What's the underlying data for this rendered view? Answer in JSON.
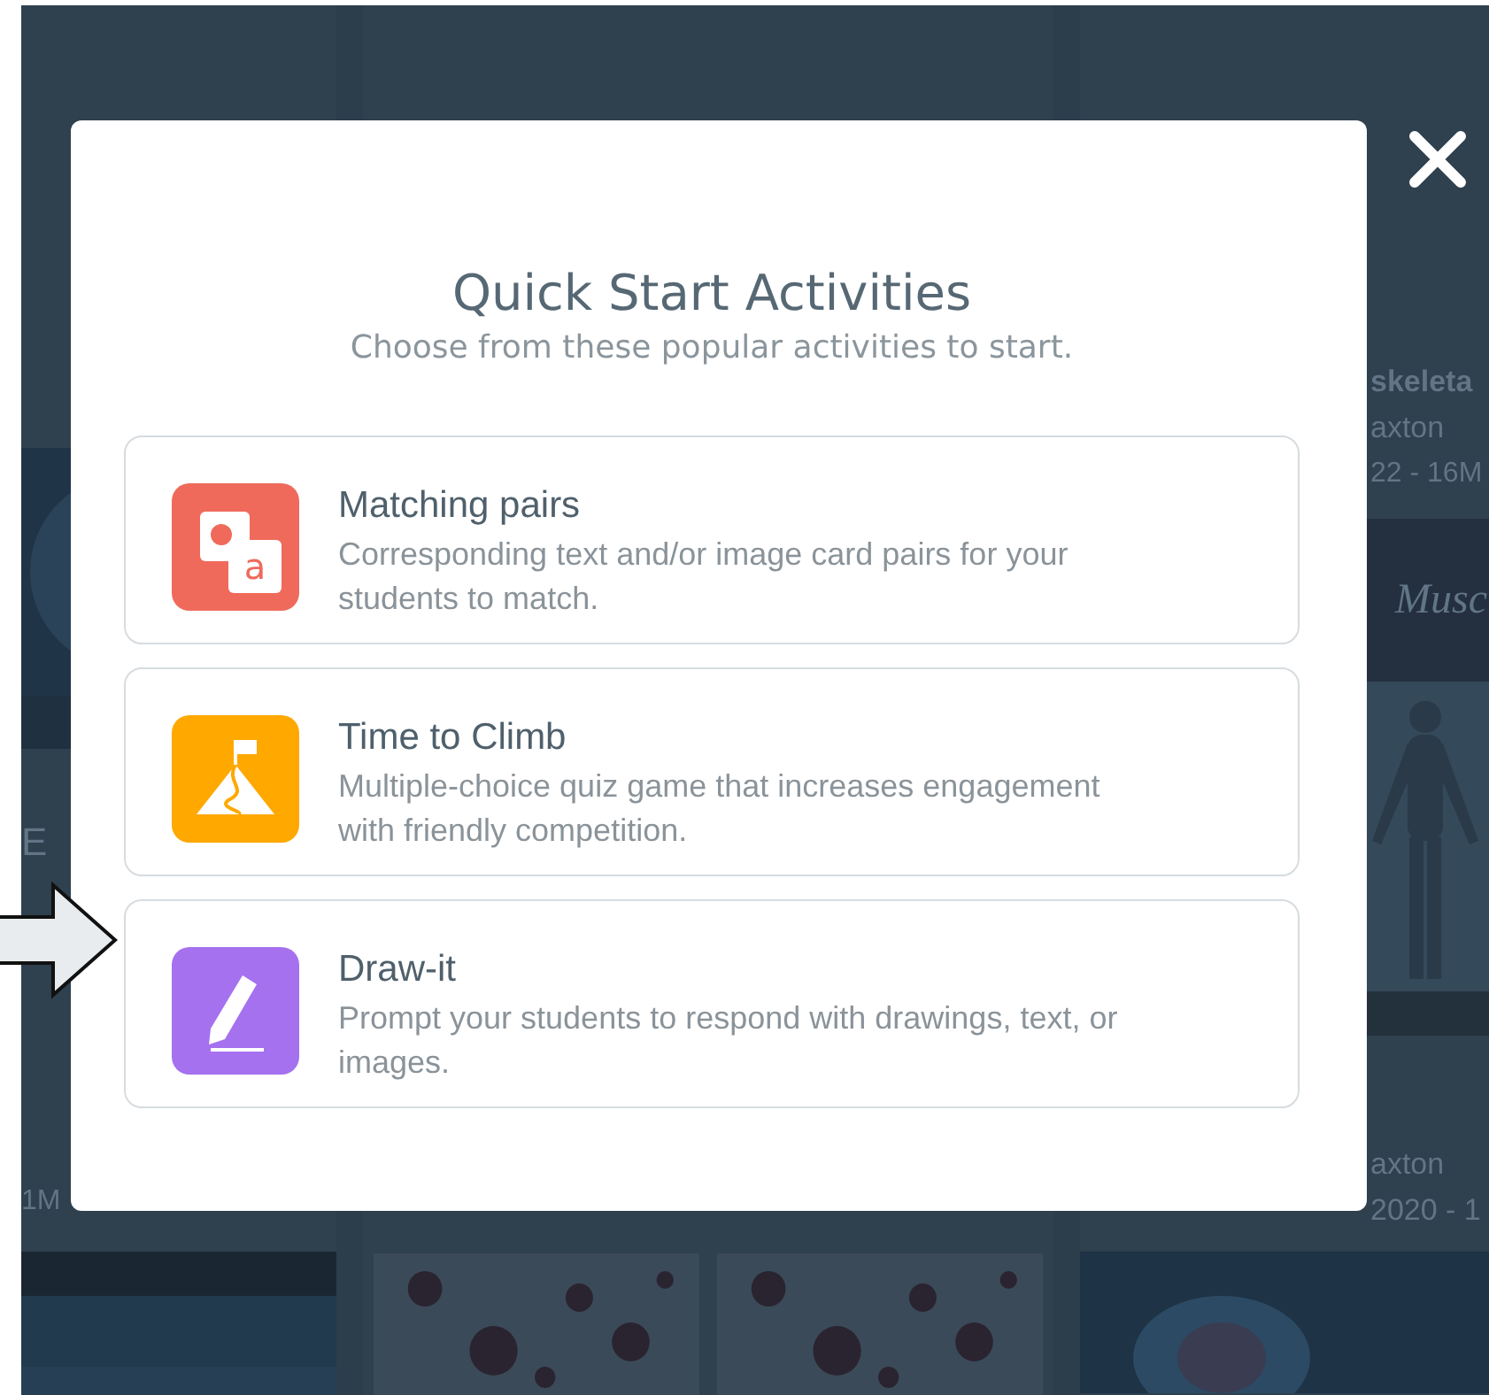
{
  "backdrop": {
    "left_column": {
      "letter": "E",
      "size": "1M"
    },
    "right_column": {
      "title": "skeleta",
      "author": "axton",
      "date": "22 - 16M",
      "banner": "Musc",
      "author_2": "axton",
      "date_2": "2020 - 1"
    }
  },
  "modal": {
    "title": "Quick Start Activities",
    "subtitle": "Choose from these popular activities to start.",
    "activities": [
      {
        "kind": "matching",
        "title": "Matching pairs",
        "description": "Corresponding text and/or image card pairs for your students to match.",
        "icon_letter": "a",
        "color": "#f06a5b"
      },
      {
        "kind": "climb",
        "title": "Time to Climb",
        "description": "Multiple-choice quiz game that increases engagement with friendly competition.",
        "color": "#ffa800"
      },
      {
        "kind": "draw",
        "title": "Draw-it",
        "description": "Prompt your students to respond with drawings, text, or images.",
        "color": "#a571ef"
      }
    ]
  }
}
